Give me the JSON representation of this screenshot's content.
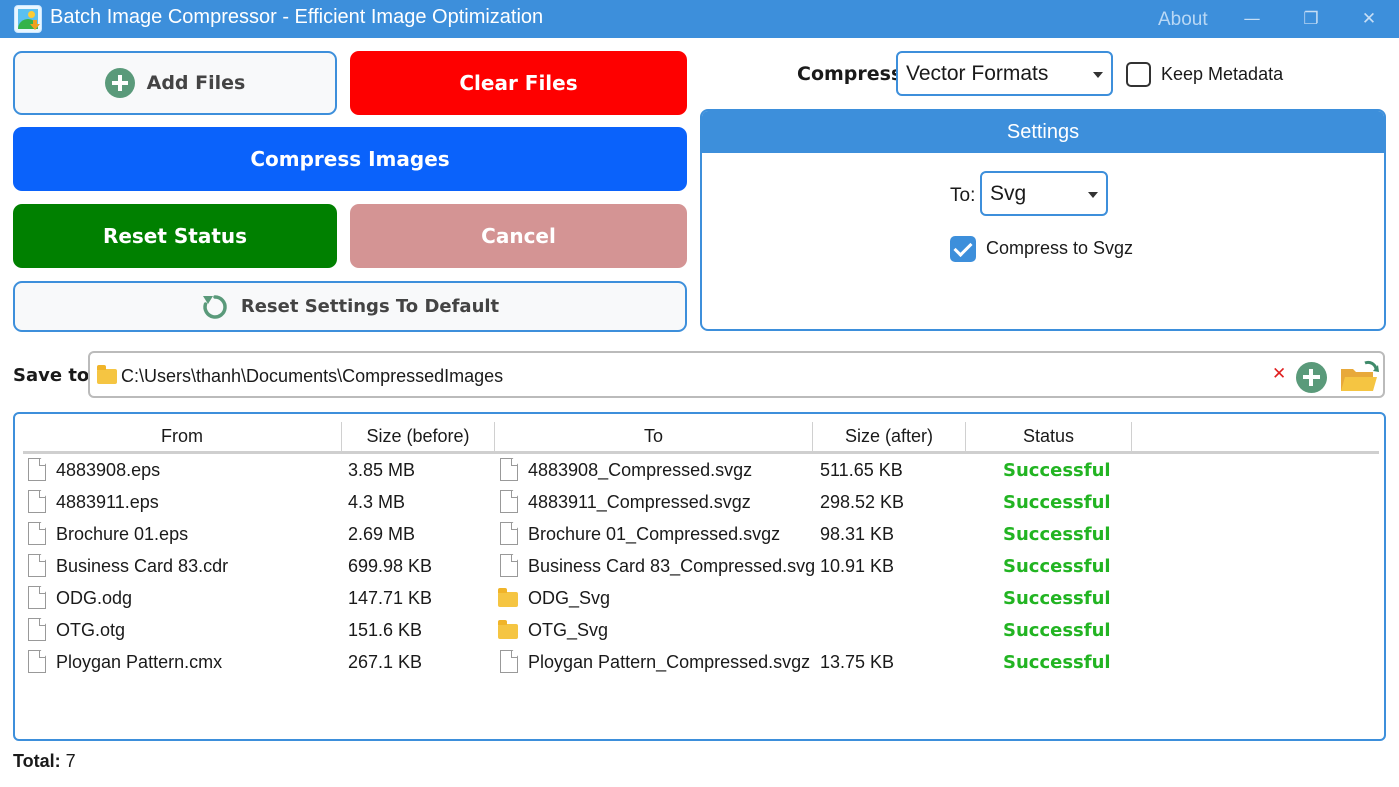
{
  "window": {
    "title": "Batch Image Compressor - Efficient Image Optimization",
    "about_label": "About",
    "minimize_glyph": "—",
    "maximize_glyph": "❐",
    "close_glyph": "✕"
  },
  "buttons": {
    "add_files": "Add Files",
    "clear_files": "Clear Files",
    "compress_images": "Compress Images",
    "reset_status": "Reset Status",
    "cancel": "Cancel",
    "reset_settings": "Reset Settings To Default"
  },
  "compress": {
    "label": "Compress:",
    "selected": "Vector Formats"
  },
  "keep_metadata": {
    "label": "Keep Metadata",
    "checked": false
  },
  "settings": {
    "title": "Settings",
    "to_label": "To:",
    "to_selected": "Svg",
    "compress_svgz_label": "Compress to Svgz",
    "compress_svgz_checked": true
  },
  "save_to": {
    "label": "Save to:",
    "path": "C:\\Users\\thanh\\Documents\\CompressedImages",
    "clear_glyph": "✕"
  },
  "table": {
    "columns": [
      "From",
      "Size (before)",
      "To",
      "Size (after)",
      "Status"
    ],
    "rows": [
      {
        "from": "4883908.eps",
        "size_before": "3.85 MB",
        "to": "4883908_Compressed.svgz",
        "to_type": "file",
        "size_after": "511.65 KB",
        "status": "Successful"
      },
      {
        "from": "4883911.eps",
        "size_before": "4.3 MB",
        "to": "4883911_Compressed.svgz",
        "to_type": "file",
        "size_after": "298.52 KB",
        "status": "Successful"
      },
      {
        "from": "Brochure 01.eps",
        "size_before": "2.69 MB",
        "to": "Brochure 01_Compressed.svgz",
        "to_type": "file",
        "size_after": "98.31 KB",
        "status": "Successful"
      },
      {
        "from": "Business Card 83.cdr",
        "size_before": "699.98 KB",
        "to": "Business Card 83_Compressed.svgz",
        "to_type": "file",
        "size_after": "10.91 KB",
        "status": "Successful"
      },
      {
        "from": "ODG.odg",
        "size_before": "147.71 KB",
        "to": "ODG_Svg",
        "to_type": "folder",
        "size_after": "",
        "status": "Successful"
      },
      {
        "from": "OTG.otg",
        "size_before": "151.6 KB",
        "to": "OTG_Svg",
        "to_type": "folder",
        "size_after": "",
        "status": "Successful"
      },
      {
        "from": "Ploygan Pattern.cmx",
        "size_before": "267.1 KB",
        "to": "Ploygan Pattern_Compressed.svgz",
        "to_type": "file",
        "size_after": "13.75 KB",
        "status": "Successful"
      }
    ]
  },
  "total": {
    "label": "Total:",
    "value": "7"
  },
  "colors": {
    "accent": "#3d8fdb",
    "clear": "#fe0000",
    "compress": "#0a62fb",
    "reset_status": "#008000",
    "cancel_disabled": "#d49494",
    "success": "#22b422"
  }
}
